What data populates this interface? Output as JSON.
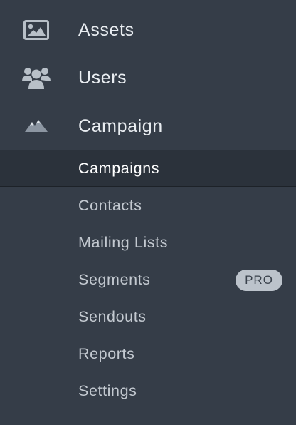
{
  "nav": {
    "items": [
      {
        "label": "Assets",
        "icon": "image-icon"
      },
      {
        "label": "Users",
        "icon": "users-icon"
      },
      {
        "label": "Campaign",
        "icon": "mountain-icon"
      }
    ]
  },
  "campaign_submenu": {
    "items": [
      {
        "label": "Campaigns",
        "active": true
      },
      {
        "label": "Contacts"
      },
      {
        "label": "Mailing Lists"
      },
      {
        "label": "Segments",
        "badge": "PRO"
      },
      {
        "label": "Sendouts"
      },
      {
        "label": "Reports"
      },
      {
        "label": "Settings"
      }
    ]
  },
  "colors": {
    "background": "#353d48",
    "active_background": "#2b323b",
    "text": "#e9edf1",
    "submenu_text": "#c3c9d0",
    "icon": "#b8c0c8",
    "badge_background": "#bcc3cb",
    "badge_text": "#39414b"
  }
}
